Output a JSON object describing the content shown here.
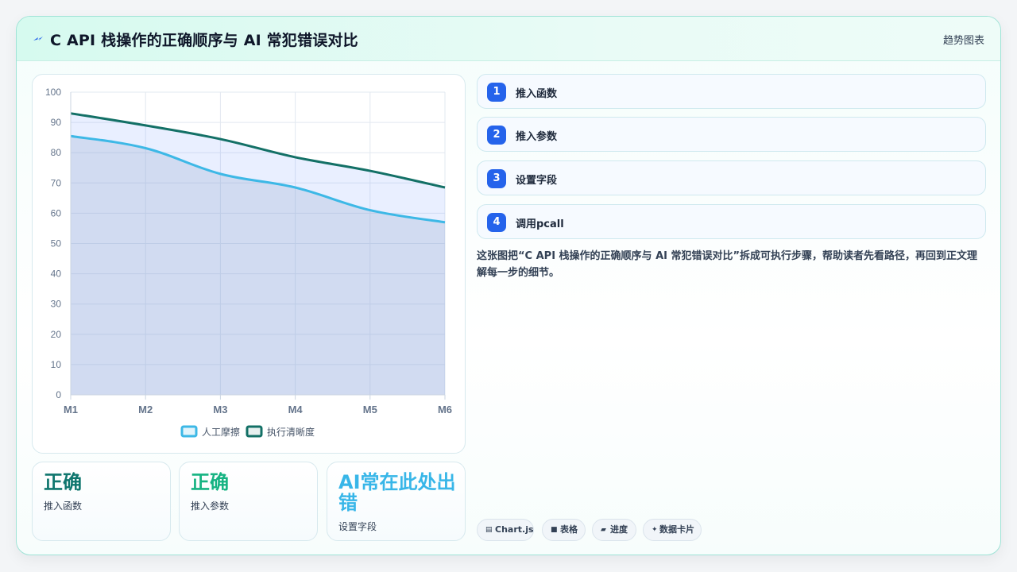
{
  "header": {
    "title": "C API 栈操作的正确顺序与 AI 常犯错误对比",
    "tag": "趋势图表",
    "icon": "lightning-icon"
  },
  "chart_data": {
    "type": "area",
    "categories": [
      "M1",
      "M2",
      "M3",
      "M4",
      "M5",
      "M6"
    ],
    "series": [
      {
        "name": "人工摩擦",
        "values": [
          85.5,
          81.5,
          73,
          68.5,
          61,
          57
        ],
        "color": "#3db8e6"
      },
      {
        "name": "执行清晰度",
        "values": [
          93,
          89,
          84.5,
          78.5,
          74,
          68.5
        ],
        "color": "#137066"
      }
    ],
    "ylim": [
      0,
      100
    ],
    "yticks": [
      0,
      10,
      20,
      30,
      40,
      50,
      60,
      70,
      80,
      90,
      100
    ],
    "grid": true,
    "legend": "bottom"
  },
  "stats": [
    {
      "value": "正确",
      "label": "推入函数",
      "color": "#0f766e"
    },
    {
      "value": "正确",
      "label": "推入参数",
      "color": "#16b382"
    },
    {
      "value": "AI常在此处出错",
      "label": "设置字段",
      "color": "#38b6e8"
    }
  ],
  "steps": [
    {
      "num": "1",
      "label": "推入函数"
    },
    {
      "num": "2",
      "label": "推入参数"
    },
    {
      "num": "3",
      "label": "设置字段"
    },
    {
      "num": "4",
      "label": "调用pcall"
    }
  ],
  "description": "这张图把“C API 栈操作的正确顺序与 AI 常犯错误对比”拆成可执行步骤，帮助读者先看路径，再回到正文理解每一步的细节。",
  "tags": [
    {
      "icon": "▤",
      "label": "Chart.js"
    },
    {
      "icon": "■",
      "label": "表格"
    },
    {
      "icon": "▰",
      "label": "进度"
    },
    {
      "icon": "✦",
      "label": "数据卡片"
    }
  ],
  "colors": {
    "accent": "#2563eb",
    "border": "#9fe3d6"
  }
}
